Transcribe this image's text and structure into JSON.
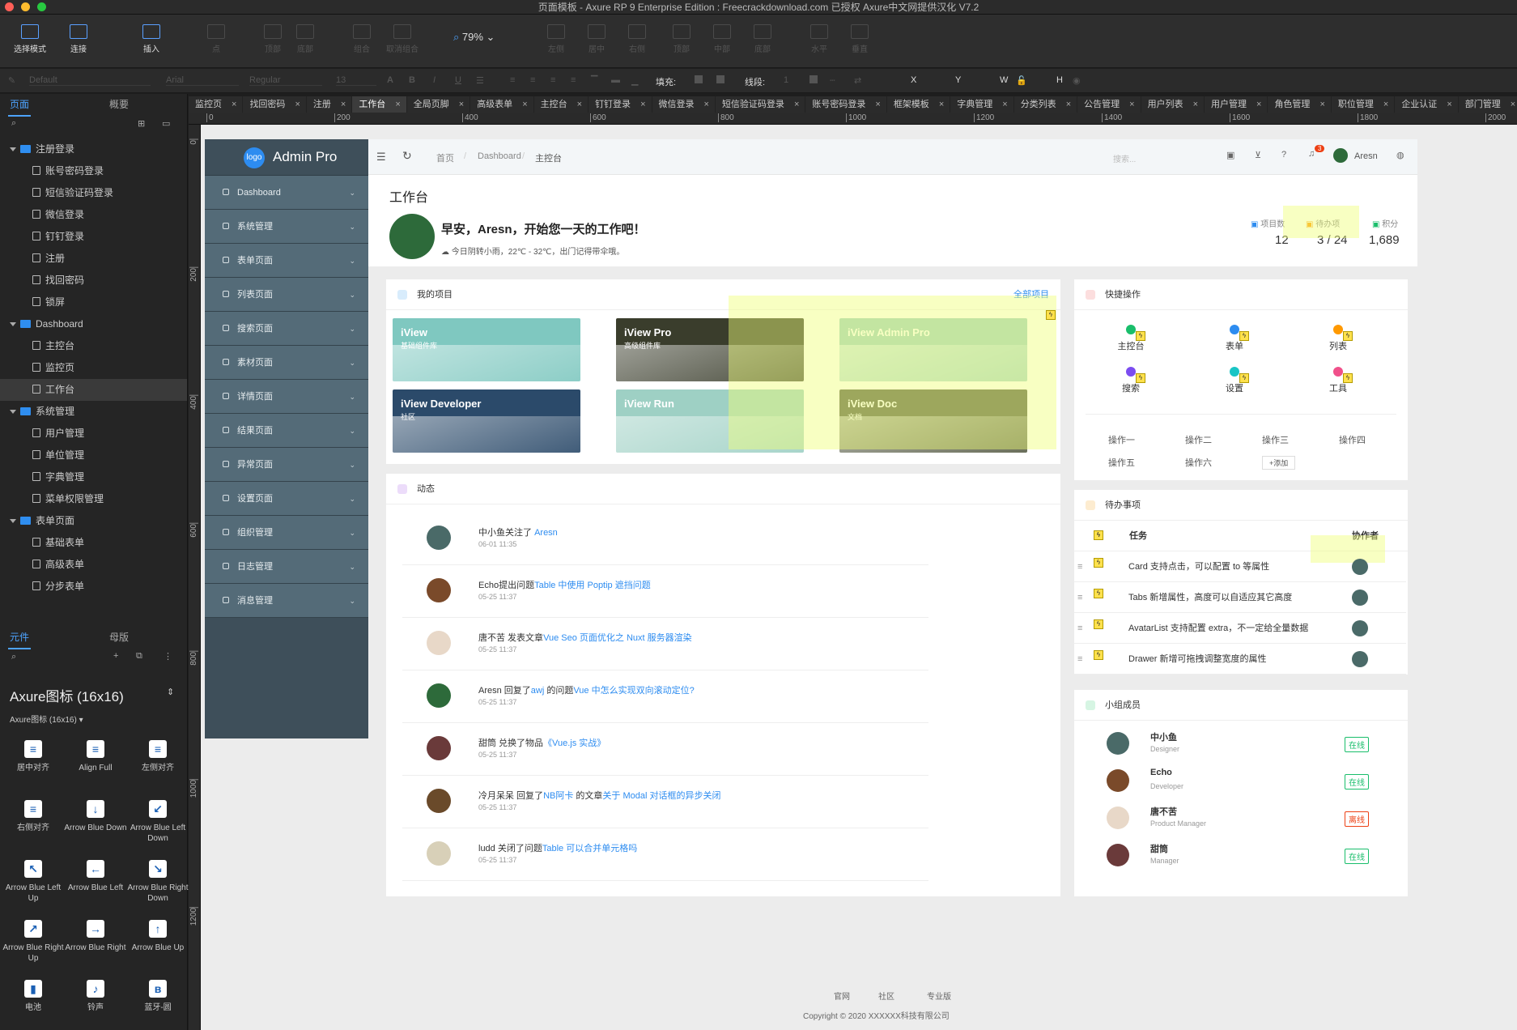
{
  "titlebar": {
    "title": "页面模板 - Axure RP 9 Enterprise Edition : Freecrackdownload.com 已授权    Axure中文网提供汉化 V7.2"
  },
  "toolbar": {
    "items": [
      "选择模式",
      "连接",
      "插入",
      "点",
      "顶部",
      "底部",
      "组合",
      "取消组合",
      "左侧",
      "居中",
      "右侧",
      "顶部",
      "中部",
      "底部",
      "水平",
      "垂直"
    ],
    "zoom": "79%"
  },
  "format": {
    "style": "Default",
    "font": "Arial",
    "weight": "Regular",
    "size": "13",
    "fill": "填充:",
    "line": "线段:",
    "line_val": "1",
    "x": "X",
    "y": "Y",
    "w": "W",
    "h": "H"
  },
  "left": {
    "tabs": [
      "页面",
      "概要"
    ],
    "tree": [
      {
        "type": "folder",
        "label": "注册登录",
        "depth": 0
      },
      {
        "type": "page",
        "label": "账号密码登录",
        "depth": 1
      },
      {
        "type": "page",
        "label": "短信验证码登录",
        "depth": 1
      },
      {
        "type": "page",
        "label": "微信登录",
        "depth": 1
      },
      {
        "type": "page",
        "label": "钉钉登录",
        "depth": 1
      },
      {
        "type": "page",
        "label": "注册",
        "depth": 1
      },
      {
        "type": "page",
        "label": "找回密码",
        "depth": 1
      },
      {
        "type": "page",
        "label": "锁屏",
        "depth": 1
      },
      {
        "type": "folder",
        "label": "Dashboard",
        "depth": 0
      },
      {
        "type": "page",
        "label": "主控台",
        "depth": 1
      },
      {
        "type": "page",
        "label": "监控页",
        "depth": 1
      },
      {
        "type": "page",
        "label": "工作台",
        "depth": 1,
        "selected": true
      },
      {
        "type": "folder",
        "label": "系统管理",
        "depth": 0
      },
      {
        "type": "page",
        "label": "用户管理",
        "depth": 1
      },
      {
        "type": "page",
        "label": "单位管理",
        "depth": 1
      },
      {
        "type": "page",
        "label": "字典管理",
        "depth": 1
      },
      {
        "type": "page",
        "label": "菜单权限管理",
        "depth": 1
      },
      {
        "type": "folder",
        "label": "表单页面",
        "depth": 0
      },
      {
        "type": "page",
        "label": "基础表单",
        "depth": 1
      },
      {
        "type": "page",
        "label": "高级表单",
        "depth": 1
      },
      {
        "type": "page",
        "label": "分步表单",
        "depth": 1
      }
    ],
    "lib_tabs": [
      "元件",
      "母版"
    ],
    "library_name": "Axure图标 (16x16)",
    "library_sub": "Axure图标 (16x16) ▾",
    "widgets": [
      {
        "label": "居中对齐",
        "glyph": "≡"
      },
      {
        "label": "Align Full",
        "glyph": "≡"
      },
      {
        "label": "左侧对齐",
        "glyph": "≡"
      },
      {
        "label": "右侧对齐",
        "glyph": "≡"
      },
      {
        "label": "Arrow Blue Down",
        "glyph": "↓"
      },
      {
        "label": "Arrow Blue Left Down",
        "glyph": "↙"
      },
      {
        "label": "Arrow Blue Left Up",
        "glyph": "↖"
      },
      {
        "label": "Arrow Blue Left",
        "glyph": "←"
      },
      {
        "label": "Arrow Blue Right Down",
        "glyph": "↘"
      },
      {
        "label": "Arrow Blue Right Up",
        "glyph": "↗"
      },
      {
        "label": "Arrow Blue Right",
        "glyph": "→"
      },
      {
        "label": "Arrow Blue Up",
        "glyph": "↑"
      },
      {
        "label": "电池",
        "glyph": "▮"
      },
      {
        "label": "铃声",
        "glyph": "♪"
      },
      {
        "label": "蓝牙-圆",
        "glyph": "ʙ"
      }
    ]
  },
  "page_tabs": [
    "监控页",
    "找回密码",
    "注册",
    "工作台",
    "全局页脚",
    "高级表单",
    "主控台",
    "钉钉登录",
    "微信登录",
    "短信验证码登录",
    "账号密码登录",
    "框架模板",
    "字典管理",
    "分类列表",
    "公告管理",
    "用户列表",
    "用户管理",
    "角色管理",
    "职位管理",
    "企业认证",
    "部门管理"
  ],
  "active_page_tab": "工作台",
  "ruler": {
    "h": [
      "0",
      "200",
      "400",
      "600",
      "800",
      "1000",
      "1200",
      "1400",
      "1600",
      "1800",
      "2000"
    ],
    "v": [
      "0",
      "200",
      "400",
      "600",
      "800",
      "1000",
      "1200"
    ]
  },
  "app": {
    "logo_badge": "logo",
    "logo_text": "Admin Pro",
    "menu": [
      "Dashboard",
      "系统管理",
      "表单页面",
      "列表页面",
      "搜索页面",
      "素材页面",
      "详情页面",
      "结果页面",
      "异常页面",
      "设置页面",
      "组织管理",
      "日志管理",
      "消息管理"
    ],
    "breadcrumb": [
      "首页",
      "Dashboard",
      "主控台"
    ],
    "search_placeholder": "搜索...",
    "notify_count": "3",
    "user": "Aresn",
    "page_title": "工作台",
    "greeting": "早安，Aresn，开始您一天的工作吧！",
    "weather": "今日阴转小雨，22℃ - 32℃，出门记得带伞哦。",
    "stats": [
      {
        "label": "项目数",
        "value": "12"
      },
      {
        "label": "待办项",
        "value": "3 / 24"
      },
      {
        "label": "积分",
        "value": "1,689"
      }
    ],
    "projects_title": "我的项目",
    "projects_all": "全部项目",
    "projects": [
      {
        "title": "iView",
        "sub": "基础组件库",
        "bg": "#7fc8c0"
      },
      {
        "title": "iView Pro",
        "sub": "高级组件库",
        "bg": "#3a3d2c"
      },
      {
        "title": "iView Admin Pro",
        "sub": "",
        "bg": "#9ed0c4"
      },
      {
        "title": "iView Developer",
        "sub": "社区",
        "bg": "#2b4a6a"
      },
      {
        "title": "iView Run",
        "sub": "",
        "bg": "#9ed0c4"
      },
      {
        "title": "iView Doc",
        "sub": "文档",
        "bg": "#5a5f48"
      }
    ],
    "feed_title": "动态",
    "feed": [
      {
        "pre": "中小鱼关注了 ",
        "link": "Aresn",
        "mid": "",
        "link2": "",
        "date": "06-01 11:35",
        "av": "#4a6a68"
      },
      {
        "pre": "Echo提出问题",
        "link": "Table 中使用 Poptip 遮挡问题",
        "mid": "",
        "link2": "",
        "date": "05-25 11:37",
        "av": "#7a4a2a"
      },
      {
        "pre": "唐不苦 发表文章",
        "link": "Vue Seo 页面优化之 Nuxt 服务器渲染",
        "mid": "",
        "link2": "",
        "date": "05-25 11:37",
        "av": "#e8d8c8"
      },
      {
        "pre": "Aresn 回复了",
        "link": "awj",
        "mid": " 的问题",
        "link2": "Vue 中怎么实现双向滚动定位?",
        "date": "05-25 11:37",
        "av": "#2d6a3a"
      },
      {
        "pre": "甜筒 兑换了物品",
        "link": "《Vue.js 实战》",
        "mid": "",
        "link2": "",
        "date": "05-25 11:37",
        "av": "#6a3a3a"
      },
      {
        "pre": "冷月呆呆 回复了",
        "link": "NB阿卡",
        "mid": " 的文章",
        "link2": "关于 Modal 对话框的异步关闭",
        "date": "05-25 11:37",
        "av": "#6a4a2a"
      },
      {
        "pre": "ludd 关闭了问题",
        "link": "Table 可以合并单元格吗",
        "mid": "",
        "link2": "",
        "date": "05-25 11:37",
        "av": "#d8d0b8"
      }
    ],
    "quick_title": "快捷操作",
    "quick": [
      {
        "label": "主控台",
        "color": "#19be6b"
      },
      {
        "label": "表单",
        "color": "#2d8cf0"
      },
      {
        "label": "列表",
        "color": "#ff9900"
      },
      {
        "label": "搜索",
        "color": "#7b4cf0"
      },
      {
        "label": "设置",
        "color": "#19c5c5"
      },
      {
        "label": "工具",
        "color": "#f0508a"
      }
    ],
    "ops": [
      "操作一",
      "操作二",
      "操作三",
      "操作四",
      "操作五",
      "操作六",
      "+添加"
    ],
    "todo_title": "待办事项",
    "todo_cols": [
      "任务",
      "协作者"
    ],
    "todos": [
      "Card 支持点击，可以配置 to 等属性",
      "Tabs 新增属性，高度可以自适应其它高度",
      "AvatarList 支持配置 extra，不一定给全量数据",
      "Drawer 新增可拖拽调整宽度的属性"
    ],
    "team_title": "小组成员",
    "team": [
      {
        "name": "中小鱼",
        "role": "Designer",
        "status": "在线",
        "color": "#19be6b",
        "av": "#4a6a68"
      },
      {
        "name": "Echo",
        "role": "Developer",
        "status": "在线",
        "color": "#19be6b",
        "av": "#7a4a2a"
      },
      {
        "name": "唐不苦",
        "role": "Product Manager",
        "status": "离线",
        "color": "#ed4014",
        "av": "#e8d8c8"
      },
      {
        "name": "甜筒",
        "role": "Manager",
        "status": "在线",
        "color": "#19be6b",
        "av": "#6a3a3a"
      }
    ],
    "footer_links": [
      "官网",
      "社区",
      "专业版"
    ],
    "copyright": "Copyright © 2020 XXXXXX科技有限公司"
  },
  "colors": {
    "accent": "#2d8cf0",
    "sidebar": "#3e4f5a",
    "menu": "#546b78"
  }
}
